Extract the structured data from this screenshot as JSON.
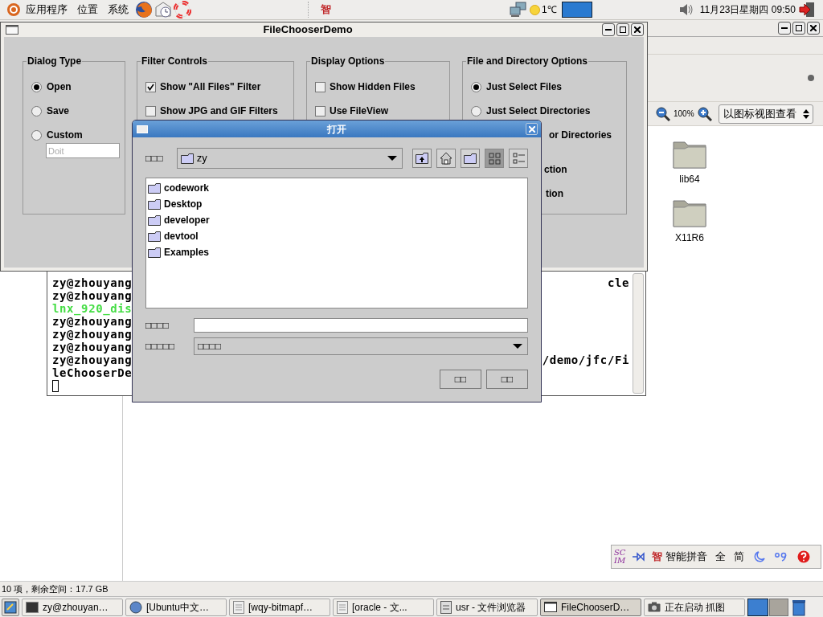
{
  "top_panel": {
    "menus": [
      "应用程序",
      "位置",
      "系统"
    ],
    "center_glyph": "智",
    "weather": "1℃",
    "clock": "11月23日星期四 09:50"
  },
  "file_browser": {
    "zoom": "100%",
    "view_mode": "以图标视图查看",
    "items": [
      "lib64",
      "X11R6"
    ],
    "status": "10 项，剩余空间：17.7 GB"
  },
  "terminal": {
    "lines": [
      {
        "kind": "prompt",
        "left": "zy@zhouyang",
        "right": "cle"
      },
      {
        "kind": "prompt",
        "left": "zy@zhouyang"
      },
      {
        "kind": "highlight",
        "left": "lnx_920_dis"
      },
      {
        "kind": "prompt",
        "left": "zy@zhouyang"
      },
      {
        "kind": "prompt",
        "left": "zy@zhouyang"
      },
      {
        "kind": "prompt",
        "left": "zy@zhouyang"
      },
      {
        "kind": "prompt",
        "left": "zy@zhouyang",
        "right": "/demo/jfc/Fi"
      },
      {
        "kind": "prompt",
        "left": "leChooserDe"
      },
      {
        "kind": "cursor"
      }
    ]
  },
  "demo_window": {
    "title": "FileChooserDemo",
    "groups": [
      {
        "title": "Dialog Type",
        "options": [
          {
            "kind": "radio",
            "label": "Open",
            "checked": true
          },
          {
            "kind": "radio",
            "label": "Save",
            "checked": false
          },
          {
            "kind": "radio",
            "label": "Custom",
            "checked": false
          },
          {
            "kind": "field",
            "value": "Doit",
            "disabled": true
          }
        ]
      },
      {
        "title": "Filter Controls",
        "options": [
          {
            "kind": "checkbox",
            "label": "Show \"All Files\" Filter",
            "checked": true
          },
          {
            "kind": "checkbox",
            "label": "Show JPG and GIF Filters",
            "checked": false
          }
        ]
      },
      {
        "title": "Display Options",
        "options": [
          {
            "kind": "checkbox",
            "label": "Show Hidden Files",
            "checked": false
          },
          {
            "kind": "checkbox",
            "label": "Use FileView",
            "checked": false
          }
        ]
      },
      {
        "title": "File and Directory Options",
        "options": [
          {
            "kind": "radio",
            "label": "Just Select Files",
            "checked": true
          },
          {
            "kind": "radio",
            "label": "Just Select Directories",
            "checked": false
          },
          {
            "kind": "fragment",
            "label": "or Directories"
          },
          {
            "kind": "fragment",
            "label": "ction"
          },
          {
            "kind": "fragment",
            "label": "tion"
          }
        ]
      }
    ]
  },
  "open_dialog": {
    "title": "打开",
    "look_in_label": "□□□",
    "look_in": "zy",
    "toolbar": [
      {
        "kind": "up",
        "selected": false
      },
      {
        "kind": "home",
        "selected": false
      },
      {
        "kind": "new_folder",
        "selected": false
      },
      {
        "kind": "list",
        "selected": true
      },
      {
        "kind": "details",
        "selected": false
      }
    ],
    "files": [
      "codework",
      "Desktop",
      "developer",
      "devtool",
      "Examples"
    ],
    "file_name_label": "□□□□",
    "file_type_label": "□□□□□",
    "file_type": "□□□□",
    "buttons": [
      "□□",
      "□□"
    ]
  },
  "input_method_bar": {
    "logo": [
      "SC",
      "IM"
    ],
    "glyph": "智",
    "mode": "智能拼音",
    "width": "全",
    "script": "简"
  },
  "taskbar": {
    "items": [
      {
        "kind": "terminal",
        "label": "zy@zhouyan…",
        "selected": false
      },
      {
        "kind": "globe",
        "label": "[Ubuntu中文…",
        "selected": false
      },
      {
        "kind": "document",
        "label": "[wqy-bitmapf…",
        "selected": false
      },
      {
        "kind": "document",
        "label": "[oracle - 文...",
        "selected": false
      },
      {
        "kind": "folder",
        "label": "usr - 文件浏览器",
        "selected": false
      },
      {
        "kind": "window",
        "label": "FileChooserD…",
        "selected": true
      },
      {
        "kind": "camera",
        "label": "正在启动 抓图",
        "selected": false
      }
    ]
  }
}
